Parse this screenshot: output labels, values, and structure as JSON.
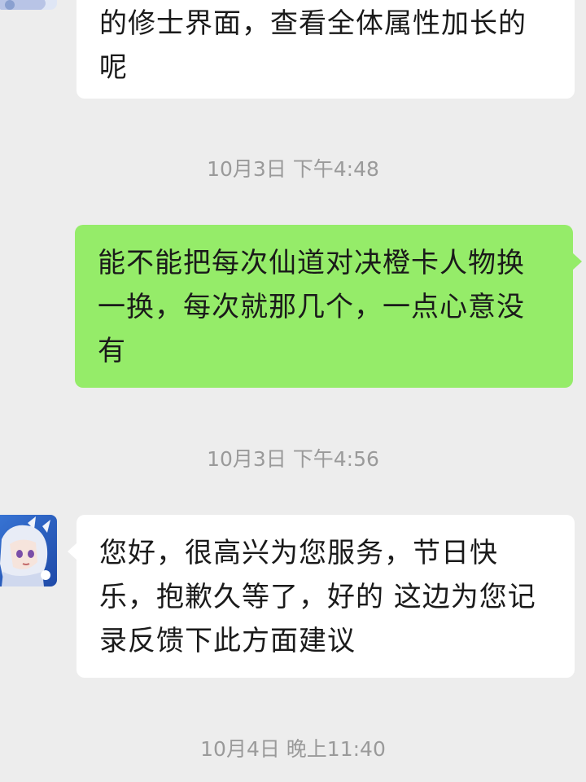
{
  "chat": {
    "messages": [
      {
        "sender": "agent",
        "text": "的修士界面，查看全体属性加长的呢"
      },
      {
        "sender": "me",
        "text": "能不能把每次仙道对决橙卡人物换一换，每次就那几个，一点心意没有"
      },
      {
        "sender": "agent",
        "text": "您好，很高兴为您服务，节日快乐，抱歉久等了，好的 这边为您记录反馈下此方面建议"
      }
    ],
    "timestamps": [
      "10月3日 下午4:48",
      "10月3日 下午4:56",
      "10月4日 晚上11:40"
    ]
  },
  "colors": {
    "background": "#ededed",
    "incoming_bubble": "#ffffff",
    "outgoing_bubble": "#95ec69",
    "timestamp_text": "#9a9a9a"
  },
  "icons": {
    "agent_avatar": "anime-character-avatar-icon"
  }
}
